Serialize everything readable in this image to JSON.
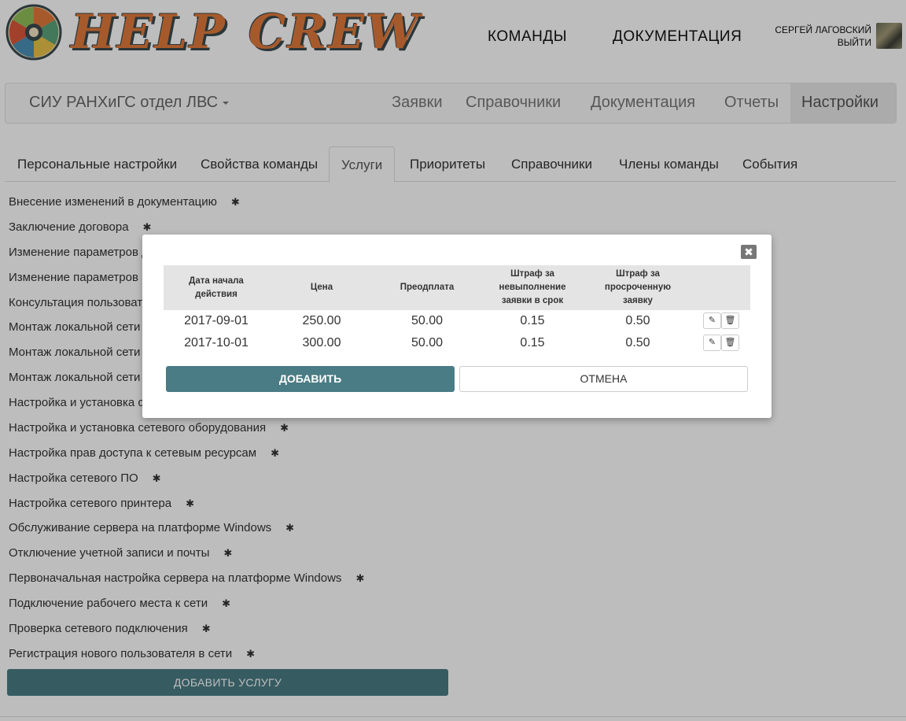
{
  "header": {
    "logo_text_1": "HELP",
    "logo_text_2": "CREW",
    "nav": [
      "КОМАНДЫ",
      "ДОКУМЕНТАЦИЯ"
    ],
    "user_name": "СЕРГЕЙ ЛАГОВСКИЙ",
    "logout": "ВЫЙТИ"
  },
  "navbar": {
    "team": "СИУ РАНХиГС отдел ЛВС",
    "items": [
      "Заявки",
      "Справочники",
      "Документация",
      "Отчеты"
    ],
    "active": "Настройки"
  },
  "tabs": [
    "Персональные настройки",
    "Свойства команды",
    "Услуги",
    "Приоритеты",
    "Справочники",
    "Члены команды",
    "События"
  ],
  "active_tab": "Услуги",
  "services": [
    "Внесение изменений в документацию",
    "Заключение договора",
    "Изменение параметров д",
    "Изменение параметров п",
    "Консультация пользовате",
    "Монтаж локальной сети н",
    "Монтаж локальной сети н",
    "Монтаж локальной сети с",
    "Настройка и установка се",
    "Настройка и установка сетевого оборудования",
    "Настройка прав доступа к сетевым ресурсам",
    "Настройка сетевого ПО",
    "Настройка сетевого принтера",
    "Обслуживание сервера на платформе Windows",
    "Отключение учетной записи и почты",
    "Первоначальная настройка сервера на платформе Windows",
    "Подключение рабочего места к сети",
    "Проверка сетевого подключения",
    "Регистрация нового пользователя в сети"
  ],
  "add_service_label": "ДОБАВИТЬ УСЛУГУ",
  "modal": {
    "close_symbol": "✖",
    "columns": [
      "Дата начала действия",
      "Цена",
      "Преодплата",
      "Штраф за невыполнение заявки в срок",
      "Штраф за просроченную заявку"
    ],
    "rows": [
      [
        "2017-09-01",
        "250.00",
        "50.00",
        "0.15",
        "0.50"
      ],
      [
        "2017-10-01",
        "300.00",
        "50.00",
        "0.15",
        "0.50"
      ]
    ],
    "add_label": "ДОБАВИТЬ",
    "cancel_label": "ОТМЕНА"
  },
  "colors": {
    "primary": "#4a7c85",
    "logo_orange": "#e07a3a",
    "logo_outline": "#3a4a4e"
  }
}
